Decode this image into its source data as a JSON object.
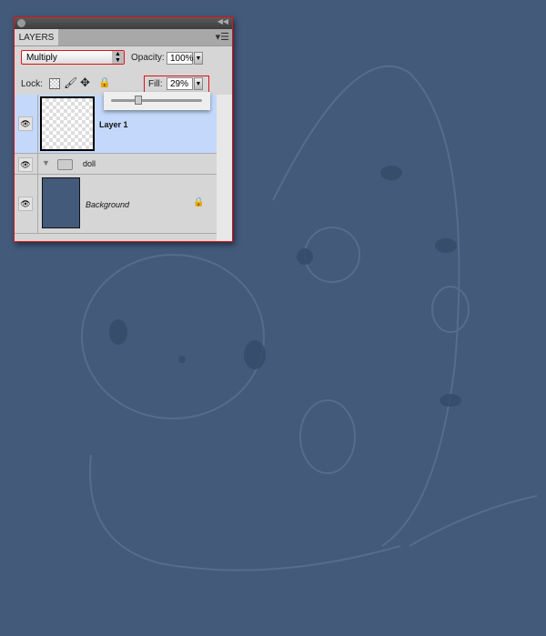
{
  "panel": {
    "tab": "LAYERS",
    "blend_mode": "Multiply",
    "opacity_label": "Opacity:",
    "opacity": "100%",
    "lock_label": "Lock:",
    "fill_label": "Fill:",
    "fill": "29%",
    "fill_slider_percent": 29,
    "layers": [
      {
        "name": "Layer 1",
        "visible": true,
        "selected": true,
        "type": "layer"
      },
      {
        "name": "doll",
        "visible": true,
        "type": "group",
        "expanded": true
      },
      {
        "name": "Background",
        "visible": true,
        "locked": true,
        "type": "background"
      }
    ]
  },
  "colors": {
    "canvas": "#435a7b",
    "selection": "#c3d8fb",
    "highlight": "#e0101a"
  }
}
